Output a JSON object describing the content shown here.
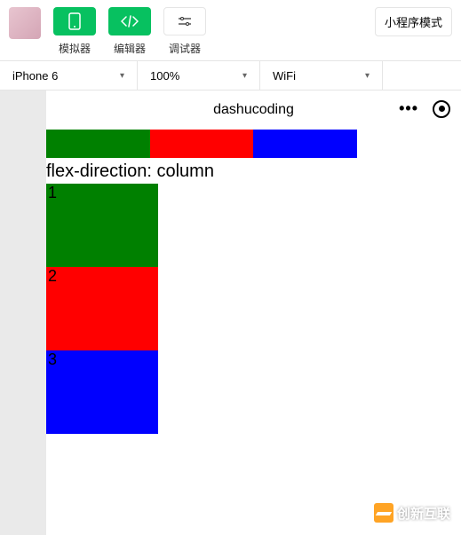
{
  "toolbar": {
    "simulator_label": "模拟器",
    "editor_label": "编辑器",
    "debugger_label": "调试器",
    "mode_label": "小程序模式"
  },
  "selectors": {
    "device": "iPhone 6",
    "zoom": "100%",
    "network": "WiFi"
  },
  "sim": {
    "title": "dashucoding",
    "section_label": "flex-direction: column",
    "col_items": [
      "1",
      "2",
      "3"
    ]
  },
  "watermark": "创新互联"
}
